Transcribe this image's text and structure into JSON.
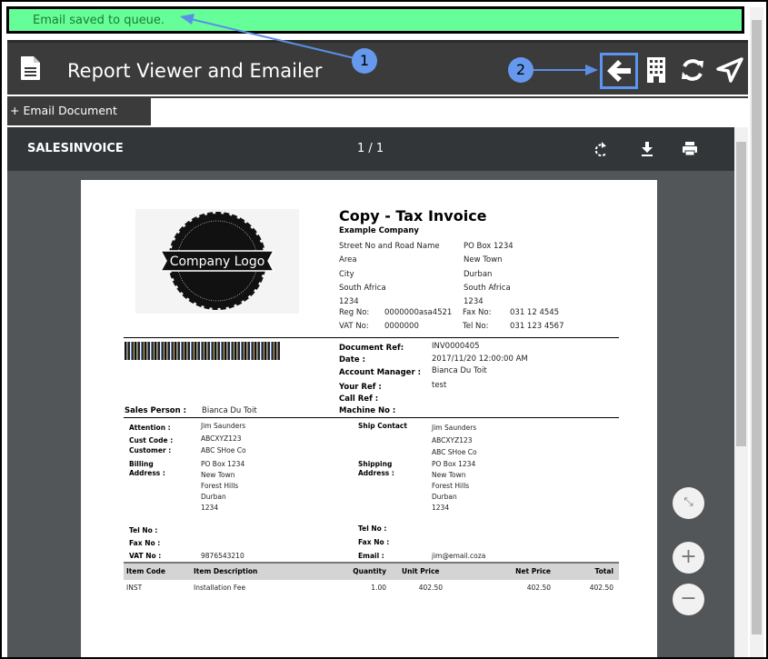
{
  "toast": {
    "message": "Email saved to queue."
  },
  "header": {
    "title": "Report Viewer and Emailer",
    "icons": [
      "document-icon",
      "back-arrow-icon",
      "building-icon",
      "refresh-icon",
      "send-icon"
    ]
  },
  "tabs": [
    {
      "label": "+ Email Document"
    }
  ],
  "viewer": {
    "doc_name": "SALESINVOICE",
    "page_indicator": "1 / 1"
  },
  "callouts": [
    "1",
    "2"
  ],
  "invoice": {
    "title": "Copy - Tax Invoice",
    "logo_text": "Company Logo",
    "company": "Example Company",
    "address_left": [
      "Street No and Road Name",
      "Area",
      "City",
      "South Africa",
      "1234"
    ],
    "address_right": [
      "PO Box 1234",
      "New Town",
      "Durban",
      "South Africa",
      "1234"
    ],
    "reg_label": "Reg No:",
    "reg": "0000000asa4521",
    "fax_label": "Fax No:",
    "fax": "031 12 4545",
    "vat_label": "VAT No:",
    "vat": "0000000",
    "tel_label": "Tel No:",
    "tel": "031 123 4567",
    "doc_ref_label": "Document Ref:",
    "doc_ref": "INV0000405",
    "date_label": "Date :",
    "date": "2017/11/20 12:00:00 AM",
    "acct_label": "Account Manager :",
    "acct": "Bianca Du Toit",
    "your_ref_label": "Your Ref :",
    "your_ref": "test",
    "call_ref_label": "Call Ref :",
    "machine_label": "Machine No :",
    "sales_label": "Sales Person :",
    "sales": "Bianca Du Toit",
    "attention_label": "Attention :",
    "attention": "Jim Saunders",
    "cust_code_label": "Cust Code :",
    "cust_code": "ABCXYZ123",
    "customer_label": "Customer :",
    "customer": "ABC SHoe Co",
    "billing_label1": "Billing",
    "billing_label2": "Address :",
    "billing": [
      "PO Box 1234",
      "New Town",
      "Forest Hills",
      "Durban",
      "1234"
    ],
    "ship_contact_label": "Ship Contact",
    "ship_contact": [
      "Jim Saunders",
      "ABCXYZ123",
      "ABC SHoe Co"
    ],
    "shipping_label1": "Shipping",
    "shipping_label2": "Address :",
    "shipping": [
      "PO Box 1234",
      "New Town",
      "Forest Hills",
      "Durban",
      "1234"
    ],
    "tel_no_label": "Tel No :",
    "fax_no_label": "Fax No :",
    "vat_no_label": "VAT No :",
    "vat_no": "9876543210",
    "email_label": "Email :",
    "email": "jim@email.coza",
    "columns": [
      "Item Code",
      "Item Description",
      "Quantity",
      "Unit Price",
      "Net Price",
      "Total"
    ],
    "rows": [
      [
        "INST",
        "Installation Fee",
        "1.00",
        "402.50",
        "402.50",
        "402.50"
      ]
    ]
  }
}
